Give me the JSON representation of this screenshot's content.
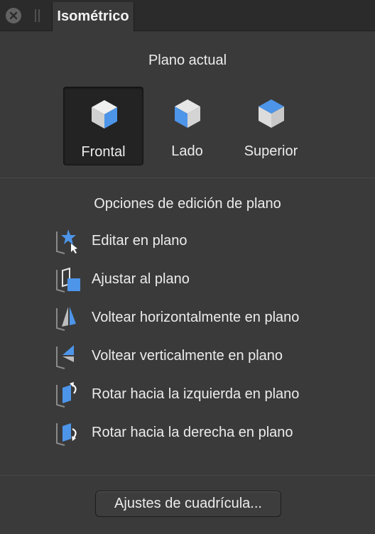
{
  "panel": {
    "tab_title": "Isométrico",
    "close_icon": "close-icon",
    "grip_icon": "drag-grip-icon"
  },
  "current_plane": {
    "title": "Plano actual",
    "selected": "Frontal",
    "buttons": [
      {
        "label": "Frontal",
        "icon": "cube-front-face-icon"
      },
      {
        "label": "Lado",
        "icon": "cube-side-face-icon"
      },
      {
        "label": "Superior",
        "icon": "cube-top-face-icon"
      }
    ]
  },
  "edit_options": {
    "title": "Opciones de edición de plano",
    "items": [
      {
        "label": "Editar en plano",
        "icon": "edit-on-plane-icon"
      },
      {
        "label": "Ajustar al plano",
        "icon": "fit-to-plane-icon"
      },
      {
        "label": "Voltear horizontalmente en plano",
        "icon": "flip-horizontal-icon"
      },
      {
        "label": "Voltear verticalmente en plano",
        "icon": "flip-vertical-icon"
      },
      {
        "label": "Rotar hacia la izquierda en plano",
        "icon": "rotate-left-icon"
      },
      {
        "label": "Rotar hacia la derecha en plano",
        "icon": "rotate-right-icon"
      }
    ]
  },
  "grid_settings": {
    "label": "Ajustes de cuadrícula..."
  },
  "colors": {
    "panel_bg": "#3a3a3a",
    "tabbar_bg": "#2b2b2b",
    "accent_blue": "#4d95e8",
    "cube_face": "#dadada",
    "selected_bg": "#232323"
  }
}
